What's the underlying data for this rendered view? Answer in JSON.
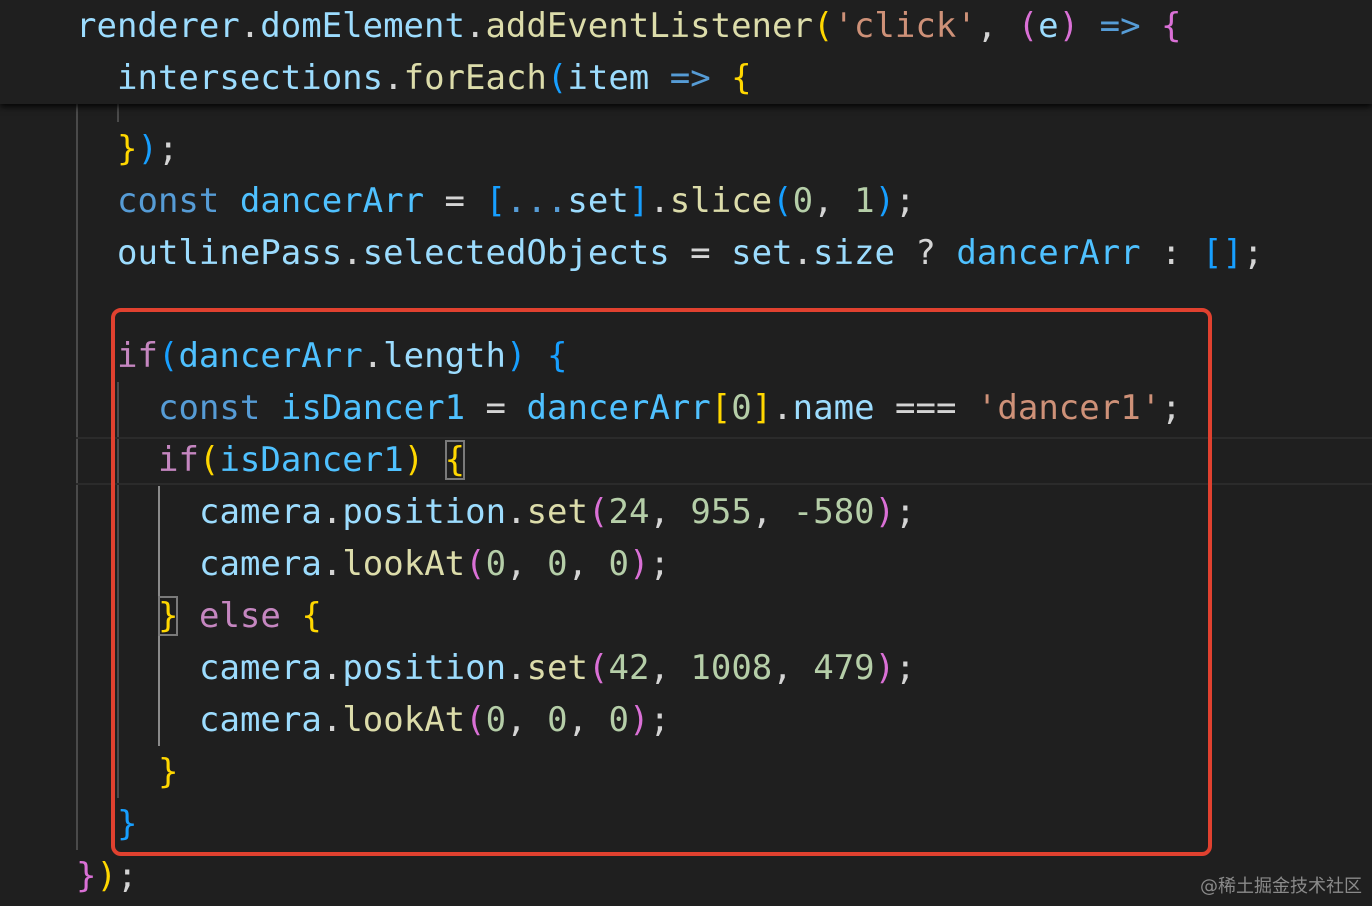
{
  "colors": {
    "background": "#1f1f1f",
    "highlight_box": "#e0412f",
    "keyword": "#569cd6",
    "control": "#c586c0",
    "variable": "#9cdcfe",
    "function": "#dcdcaa",
    "string": "#ce9178",
    "number": "#b5cea8",
    "bracket_level1": "#ffd700",
    "bracket_level2": "#da70d6",
    "bracket_level3": "#179fff"
  },
  "sticky_scroll": {
    "line1": {
      "obj": "renderer",
      "dot1": ".",
      "prop": "domElement",
      "dot2": ".",
      "method": "addEventListener",
      "paren_open": "(",
      "event": "'click'",
      "comma": ", ",
      "param_open": "(",
      "param": "e",
      "param_close": ")",
      "arrow": " => ",
      "brace": "{"
    },
    "line2": {
      "obj": "intersections",
      "dot": ".",
      "method": "forEach",
      "paren_open": "(",
      "param": "item",
      "arrow": " => ",
      "brace": "{"
    }
  },
  "code": {
    "close_foreach": {
      "brace": "}",
      "paren": ")",
      "semi": ";"
    },
    "dancer_arr": {
      "kw": "const",
      "name": "dancerArr",
      "eq": " = ",
      "bracket_open": "[",
      "spread": "...",
      "set": "set",
      "bracket_close": "]",
      "dot": ".",
      "method": "slice",
      "paren_open": "(",
      "arg1": "0",
      "comma": ", ",
      "arg2": "1",
      "paren_close": ")",
      "semi": ";"
    },
    "outline": {
      "obj": "outlinePass",
      "dot": ".",
      "prop": "selectedObjects",
      "eq": " = ",
      "set": "set",
      "dot2": ".",
      "size": "size",
      "q": " ? ",
      "arr": "dancerArr",
      "colon": " : ",
      "empty": "[]",
      "semi": ";"
    },
    "if_length": {
      "kw": "if",
      "paren_open": "(",
      "obj": "dancerArr",
      "dot": ".",
      "prop": "length",
      "paren_close": ")",
      "brace": "{"
    },
    "is_dancer": {
      "kw": "const",
      "name": "isDancer1",
      "eq": " = ",
      "arr": "dancerArr",
      "bracket_open": "[",
      "index": "0",
      "bracket_close": "]",
      "dot": ".",
      "prop": "name",
      "op": " === ",
      "str": "'dancer1'",
      "semi": ";"
    },
    "if_is_dancer": {
      "kw": "if",
      "paren_open": "(",
      "cond": "isDancer1",
      "paren_close": ")",
      "brace": "{"
    },
    "set_pos_1": {
      "obj": "camera",
      "dot1": ".",
      "prop": "position",
      "dot2": ".",
      "method": "set",
      "paren_open": "(",
      "a": "24",
      "c1": ", ",
      "b": "955",
      "c2": ", ",
      "c": "-580",
      "paren_close": ")",
      "semi": ";"
    },
    "look_at_1": {
      "obj": "camera",
      "dot": ".",
      "method": "lookAt",
      "paren_open": "(",
      "a": "0",
      "c1": ", ",
      "b": "0",
      "c2": ", ",
      "c": "0",
      "paren_close": ")",
      "semi": ";"
    },
    "else_line": {
      "close": "}",
      "kw": "else",
      "brace": "{"
    },
    "set_pos_2": {
      "obj": "camera",
      "dot1": ".",
      "prop": "position",
      "dot2": ".",
      "method": "set",
      "paren_open": "(",
      "a": "42",
      "c1": ", ",
      "b": "1008",
      "c2": ", ",
      "c": "479",
      "paren_close": ")",
      "semi": ";"
    },
    "look_at_2": {
      "obj": "camera",
      "dot": ".",
      "method": "lookAt",
      "paren_open": "(",
      "a": "0",
      "c1": ", ",
      "b": "0",
      "c2": ", ",
      "c": "0",
      "paren_close": ")",
      "semi": ";"
    },
    "close_inner_if": {
      "brace": "}"
    },
    "close_outer_if": {
      "brace": "}"
    },
    "close_listener": {
      "brace": "}",
      "paren": ")",
      "semi": ";"
    }
  },
  "watermark": "@稀土掘金技术社区"
}
